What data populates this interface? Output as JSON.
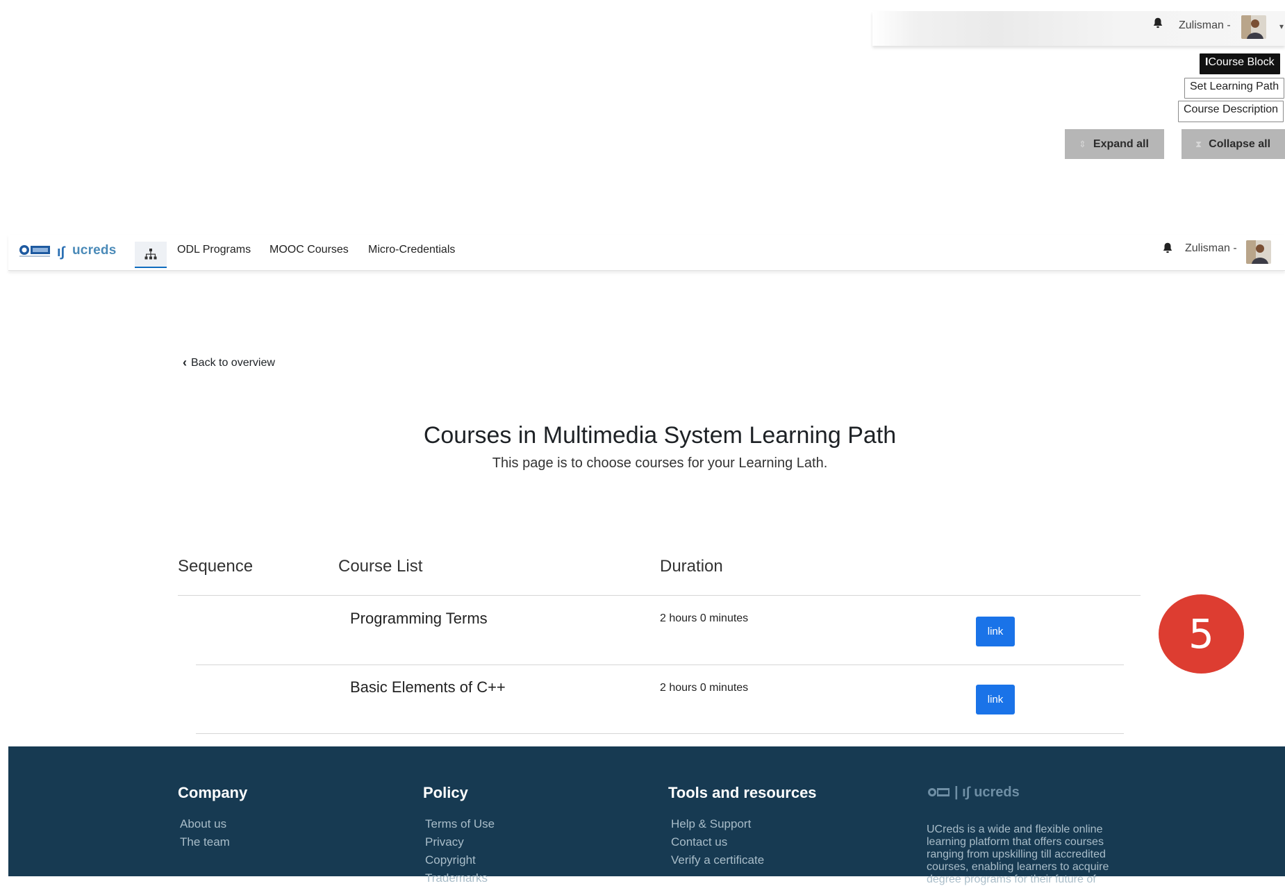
{
  "top_overlay": {
    "user_label": "Zulisman -",
    "course_block_label": "Course Block",
    "set_learning_path_label": "Set Learning Path",
    "course_description_label": "Course Description",
    "expand_all_label": "Expand all",
    "collapse_all_label": "Collapse all"
  },
  "navbar": {
    "brand": "ucreds",
    "links": [
      "ODL Programs",
      "MOOC Courses",
      "Micro-Credentials"
    ],
    "user_label": "Zulisman -"
  },
  "page": {
    "back_label": "Back to overview",
    "title": "Courses in Multimedia System Learning Path",
    "subtitle": "This page is to choose courses for your Learning Lath."
  },
  "table": {
    "headers": [
      "Sequence",
      "Course List",
      "Duration"
    ],
    "rows": [
      {
        "course": "Programming Terms",
        "duration": "2 hours 0 minutes",
        "action": "link"
      },
      {
        "course": "Basic Elements of C++",
        "duration": "2 hours 0 minutes",
        "action": "link"
      }
    ]
  },
  "step_badge": "5",
  "footer": {
    "company": {
      "heading": "Company",
      "links": [
        "About us",
        "The team"
      ]
    },
    "policy": {
      "heading": "Policy",
      "links": [
        "Terms of Use",
        "Privacy",
        "Copyright",
        "Trademarks"
      ]
    },
    "tools": {
      "heading": "Tools and resources",
      "links": [
        "Help & Support",
        "Contact us",
        "Verify a certificate"
      ]
    },
    "brand": "ucreds",
    "description": "UCreds is a wide and flexible online learning platform that offers courses ranging from upskilling till accredited courses, enabling learners to acquire degree programs for their future of"
  },
  "colors": {
    "primary": "#1a73e8",
    "footer_bg": "#173a52",
    "badge": "#dd3d31"
  }
}
